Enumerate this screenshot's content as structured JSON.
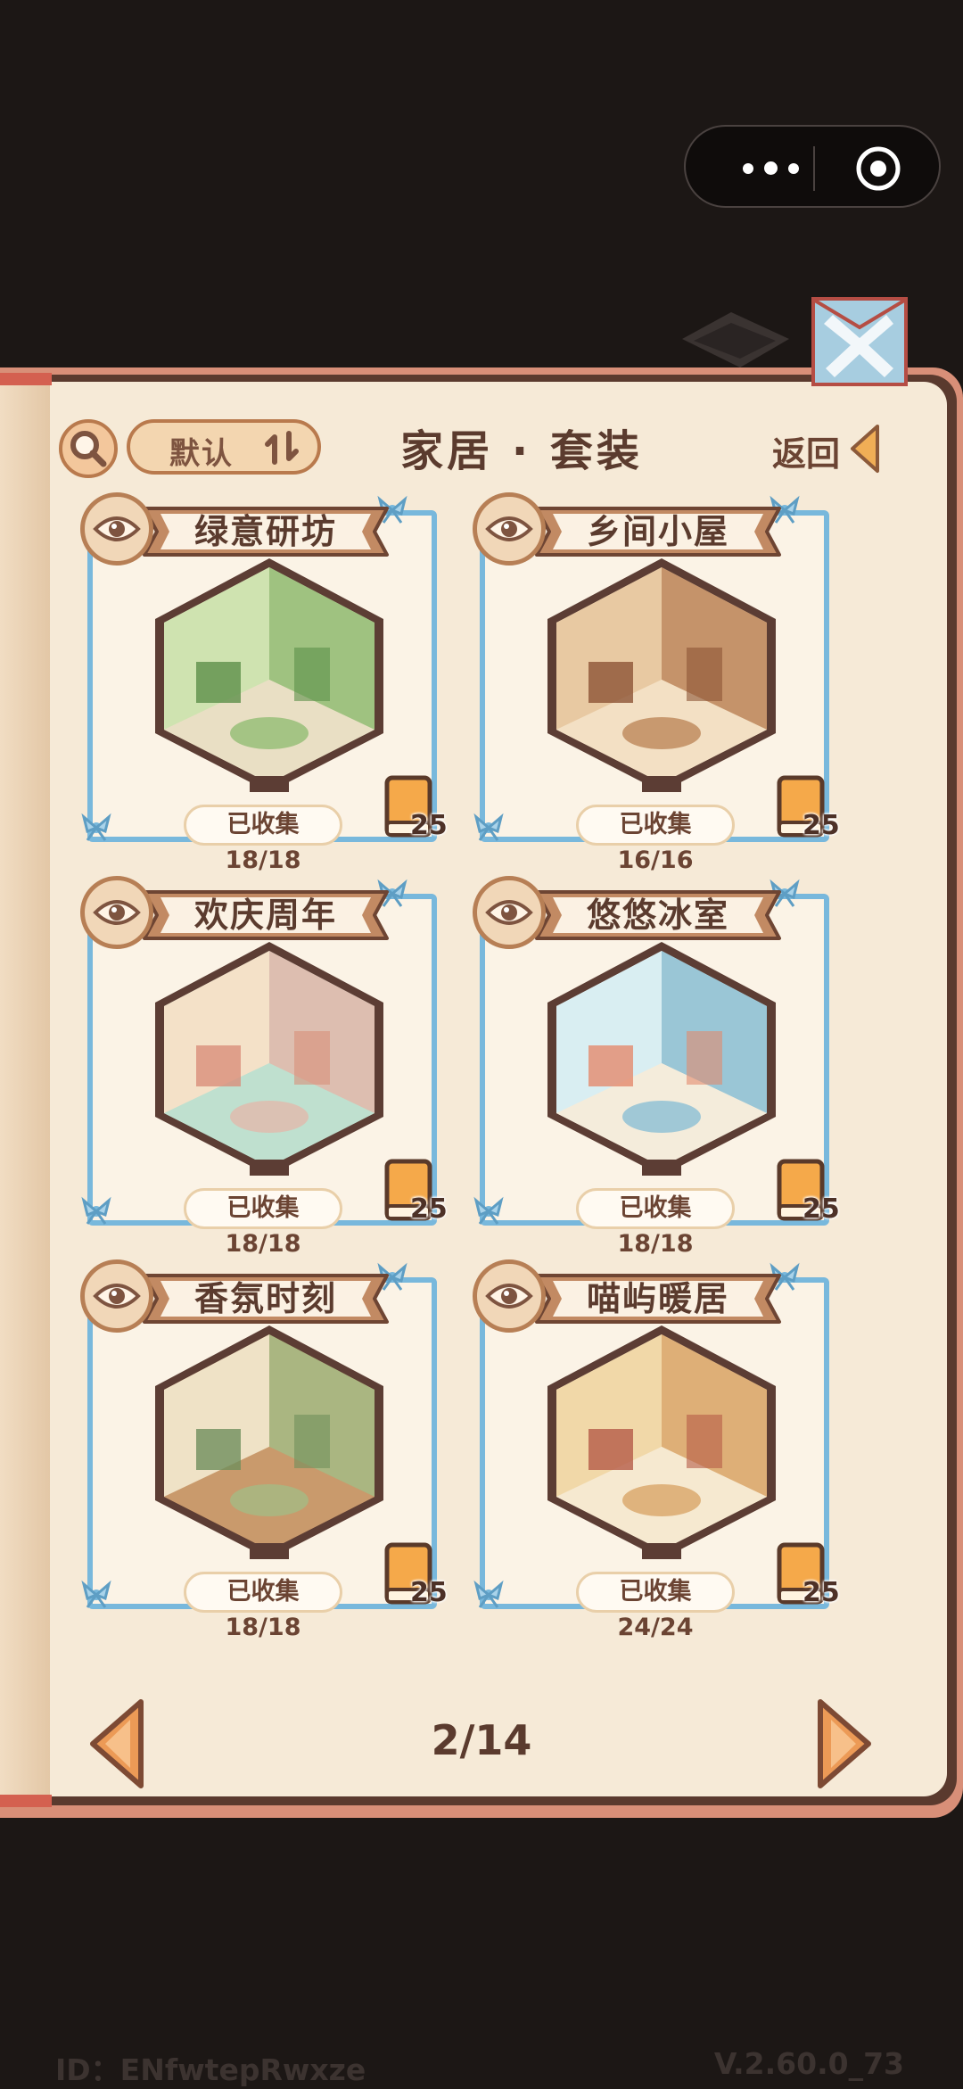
{
  "header": {
    "title": "家居 · 套装",
    "sort_label": "默认",
    "back_label": "返回",
    "search_icon": "search-icon",
    "close_icon": "close-icon"
  },
  "cards": [
    {
      "name": "绿意研坊",
      "collected": "已收集 18/18",
      "books": "25",
      "theme": "green"
    },
    {
      "name": "乡间小屋",
      "collected": "已收集 16/16",
      "books": "25",
      "theme": "wood"
    },
    {
      "name": "欢庆周年",
      "collected": "已收集 18/18",
      "books": "25",
      "theme": "party"
    },
    {
      "name": "悠悠冰室",
      "collected": "已收集 18/18",
      "books": "25",
      "theme": "ice"
    },
    {
      "name": "香氛时刻",
      "collected": "已收集 18/18",
      "books": "25",
      "theme": "bath"
    },
    {
      "name": "喵屿暖居",
      "collected": "已收集 24/24",
      "books": "25",
      "theme": "cat"
    }
  ],
  "pagination": {
    "label": "2/14"
  },
  "footer": {
    "id": "ID：ENfwtepRwxze",
    "version": "V.2.60.0_73"
  },
  "colors": {
    "frame": "#78b8dc",
    "page": "#f6ead7",
    "text": "#5b3b2e",
    "accent": "#e8a15a"
  }
}
